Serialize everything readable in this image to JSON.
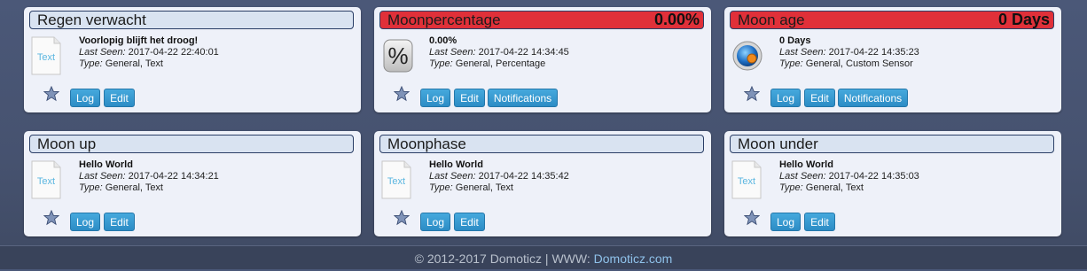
{
  "cards": [
    {
      "title": "Regen verwacht",
      "title_value": "",
      "value": "Voorlopig blijft het droog!",
      "last_seen_label": "Last Seen:",
      "last_seen": "2017-04-22 22:40:01",
      "type_label": "Type:",
      "type": "General, Text",
      "icon": "text-file-icon",
      "buttons": {
        "log": "Log",
        "edit": "Edit"
      }
    },
    {
      "title": "Moonpercentage",
      "title_value": "0.00%",
      "value": "0.00%",
      "last_seen_label": "Last Seen:",
      "last_seen": "2017-04-22 14:34:45",
      "type_label": "Type:",
      "type": "General, Percentage",
      "icon": "percent-icon",
      "buttons": {
        "log": "Log",
        "edit": "Edit",
        "notifications": "Notifications"
      }
    },
    {
      "title": "Moon age",
      "title_value": "0 Days",
      "value": "0 Days",
      "last_seen_label": "Last Seen:",
      "last_seen": "2017-04-22 14:35:23",
      "type_label": "Type:",
      "type": "General, Custom Sensor",
      "icon": "custom-sensor-icon",
      "buttons": {
        "log": "Log",
        "edit": "Edit",
        "notifications": "Notifications"
      }
    },
    {
      "title": "Moon up",
      "title_value": "",
      "value": "Hello World",
      "last_seen_label": "Last Seen:",
      "last_seen": "2017-04-22 14:34:21",
      "type_label": "Type:",
      "type": "General, Text",
      "icon": "text-file-icon",
      "buttons": {
        "log": "Log",
        "edit": "Edit"
      }
    },
    {
      "title": "Moonphase",
      "title_value": "",
      "value": "Hello World",
      "last_seen_label": "Last Seen:",
      "last_seen": "2017-04-22 14:35:42",
      "type_label": "Type:",
      "type": "General, Text",
      "icon": "text-file-icon",
      "buttons": {
        "log": "Log",
        "edit": "Edit"
      }
    },
    {
      "title": "Moon under",
      "title_value": "",
      "value": "Hello World",
      "last_seen_label": "Last Seen:",
      "last_seen": "2017-04-22 14:35:03",
      "type_label": "Type:",
      "type": "General, Text",
      "icon": "text-file-icon",
      "buttons": {
        "log": "Log",
        "edit": "Edit"
      }
    }
  ],
  "icon_text_label": "Text",
  "alert_color": "#e03039",
  "button_color": "#2c8cc5",
  "footer": {
    "copyright": "© 2012-2017 Domoticz | WWW: ",
    "link": "Domoticz.com"
  }
}
